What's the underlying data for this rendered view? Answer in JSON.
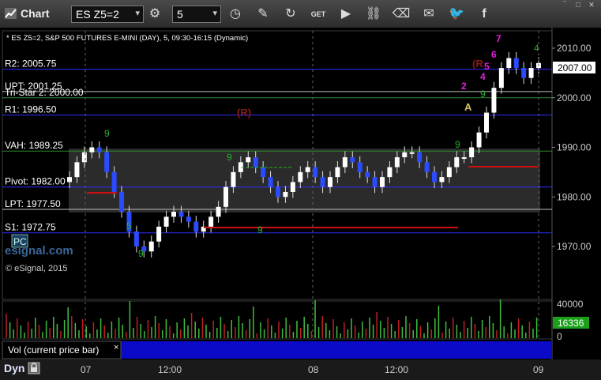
{
  "toolbar": {
    "title": "Chart",
    "symbol": "ES Z5=2",
    "interval": "5",
    "icons": [
      "settings-icon",
      "clock-icon",
      "pencil-icon",
      "refresh-icon",
      "get-icon",
      "play-icon",
      "link-icon",
      "erase-icon",
      "message-icon",
      "twitter-icon",
      "facebook-icon"
    ]
  },
  "header": "* ES Z5=2, S&P 500 FUTURES E-MINI (DAY), 5, 09:30-16:15 (Dynamic)",
  "levels": [
    {
      "label": "R2: 2005.75",
      "value": 2005.75,
      "color": "#2d2dff"
    },
    {
      "label": "UPT: 2001.25",
      "value": 2001.25,
      "color": "#bfbfbf"
    },
    {
      "label": "Tri-Star 2: 2000.00",
      "value": 2000.0,
      "color": "#2e8b2e"
    },
    {
      "label": "R1: 1996.50",
      "value": 1996.5,
      "color": "#2d2dff"
    },
    {
      "label": "VAH: 1989.25",
      "value": 1989.25,
      "color": "#2e8b2e"
    },
    {
      "label": "Pivot: 1982.00",
      "value": 1982.0,
      "color": "#2d2dff"
    },
    {
      "label": "LPT: 1977.50",
      "value": 1977.5,
      "color": "#bfbfbf"
    },
    {
      "label": "S1: 1972.75",
      "value": 1972.75,
      "color": "#2d2dff"
    }
  ],
  "price_axis": {
    "ticks": [
      "2010.00",
      "2000.00",
      "1990.00",
      "1980.00",
      "1970.00"
    ],
    "last_price": "2007.00"
  },
  "volume_axis": {
    "ticks": [
      "40000",
      "0"
    ],
    "last_volume": "16336"
  },
  "watermark": "esignal.com",
  "copyright": "© eSignal, 2015",
  "vol_label": "Vol (current price bar)",
  "vol_close": "×",
  "bottom": {
    "dyn": "Dyn",
    "dates": [
      "07",
      "12:00",
      "08",
      "12:00",
      "09"
    ]
  },
  "annotations": {
    "r_marker": "(R)",
    "a_marker": "A",
    "pc_marker": "PC"
  },
  "chart_data": {
    "type": "candlestick",
    "y_range": [
      1966,
      2015
    ],
    "ticks": [
      2010,
      2000,
      1990,
      1980,
      1970
    ],
    "closes": [
      1984,
      1987,
      1989,
      1990,
      1989,
      1985,
      1981,
      1977,
      1973,
      1970,
      1969,
      1971,
      1974,
      1976,
      1977,
      1976,
      1975,
      1973,
      1974,
      1976,
      1978,
      1982,
      1985,
      1987,
      1988,
      1986,
      1984,
      1982,
      1980,
      1981,
      1983,
      1985,
      1986,
      1984,
      1982,
      1984,
      1986,
      1988,
      1987,
      1985,
      1984,
      1982,
      1984,
      1986,
      1988,
      1989,
      1989,
      1987,
      1985,
      1983,
      1984,
      1986,
      1988,
      1988,
      1990,
      1993,
      1997,
      2002,
      2006,
      2008,
      2006,
      2004,
      2006,
      2007
    ],
    "volume_label": "Vol (current price bar)"
  }
}
